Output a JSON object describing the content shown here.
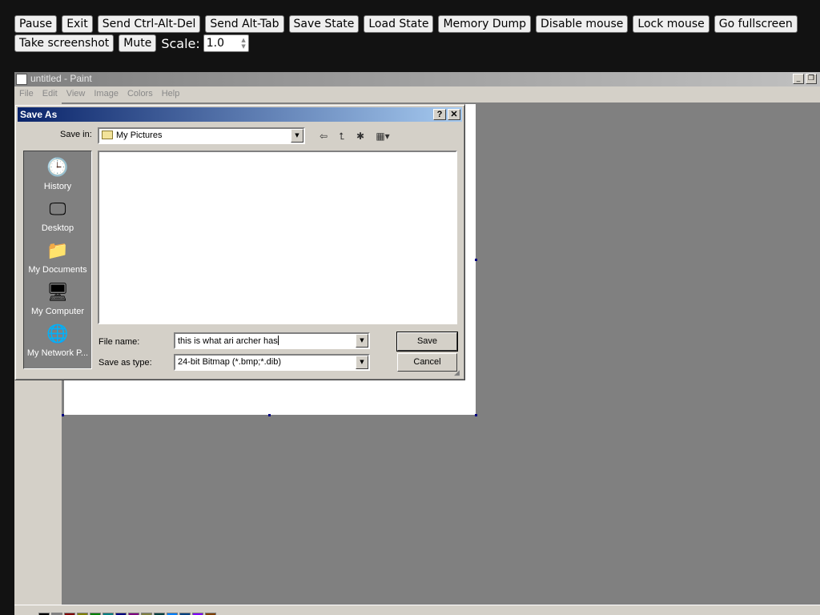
{
  "toolbar": {
    "row1": [
      "Pause",
      "Exit",
      "Send Ctrl-Alt-Del",
      "Send Alt-Tab",
      "Save State",
      "Load State",
      "Memory Dump",
      "Disable mouse",
      "Lock mouse",
      "Go fullscreen"
    ],
    "row2": [
      "Take screenshot",
      "Mute"
    ],
    "scale_label": "Scale:",
    "scale_value": "1.0"
  },
  "paint": {
    "title": "untitled - Paint",
    "menu": [
      "File",
      "Edit",
      "View",
      "Image",
      "Colors",
      "Help"
    ],
    "palette_colors": [
      "#000000",
      "#808080",
      "#800000",
      "#808000",
      "#008000",
      "#008080",
      "#000080",
      "#800080",
      "#808040",
      "#004040",
      "#0080ff",
      "#004080",
      "#8000ff",
      "#804000"
    ]
  },
  "dialog": {
    "title": "Save As",
    "help_btn": "?",
    "close_btn": "✕",
    "save_in_label": "Save in:",
    "save_in_value": "My Pictures",
    "places": [
      {
        "label": "History",
        "icon": "history-icon"
      },
      {
        "label": "Desktop",
        "icon": "desktop-icon"
      },
      {
        "label": "My Documents",
        "icon": "my-documents-icon"
      },
      {
        "label": "My Computer",
        "icon": "my-computer-icon"
      },
      {
        "label": "My Network P...",
        "icon": "network-places-icon"
      }
    ],
    "file_name_label": "File name:",
    "file_name_value": "this is what ari archer has",
    "save_type_label": "Save as type:",
    "save_type_value": "24-bit Bitmap (*.bmp;*.dib)",
    "save_button": "Save",
    "cancel_button": "Cancel"
  }
}
